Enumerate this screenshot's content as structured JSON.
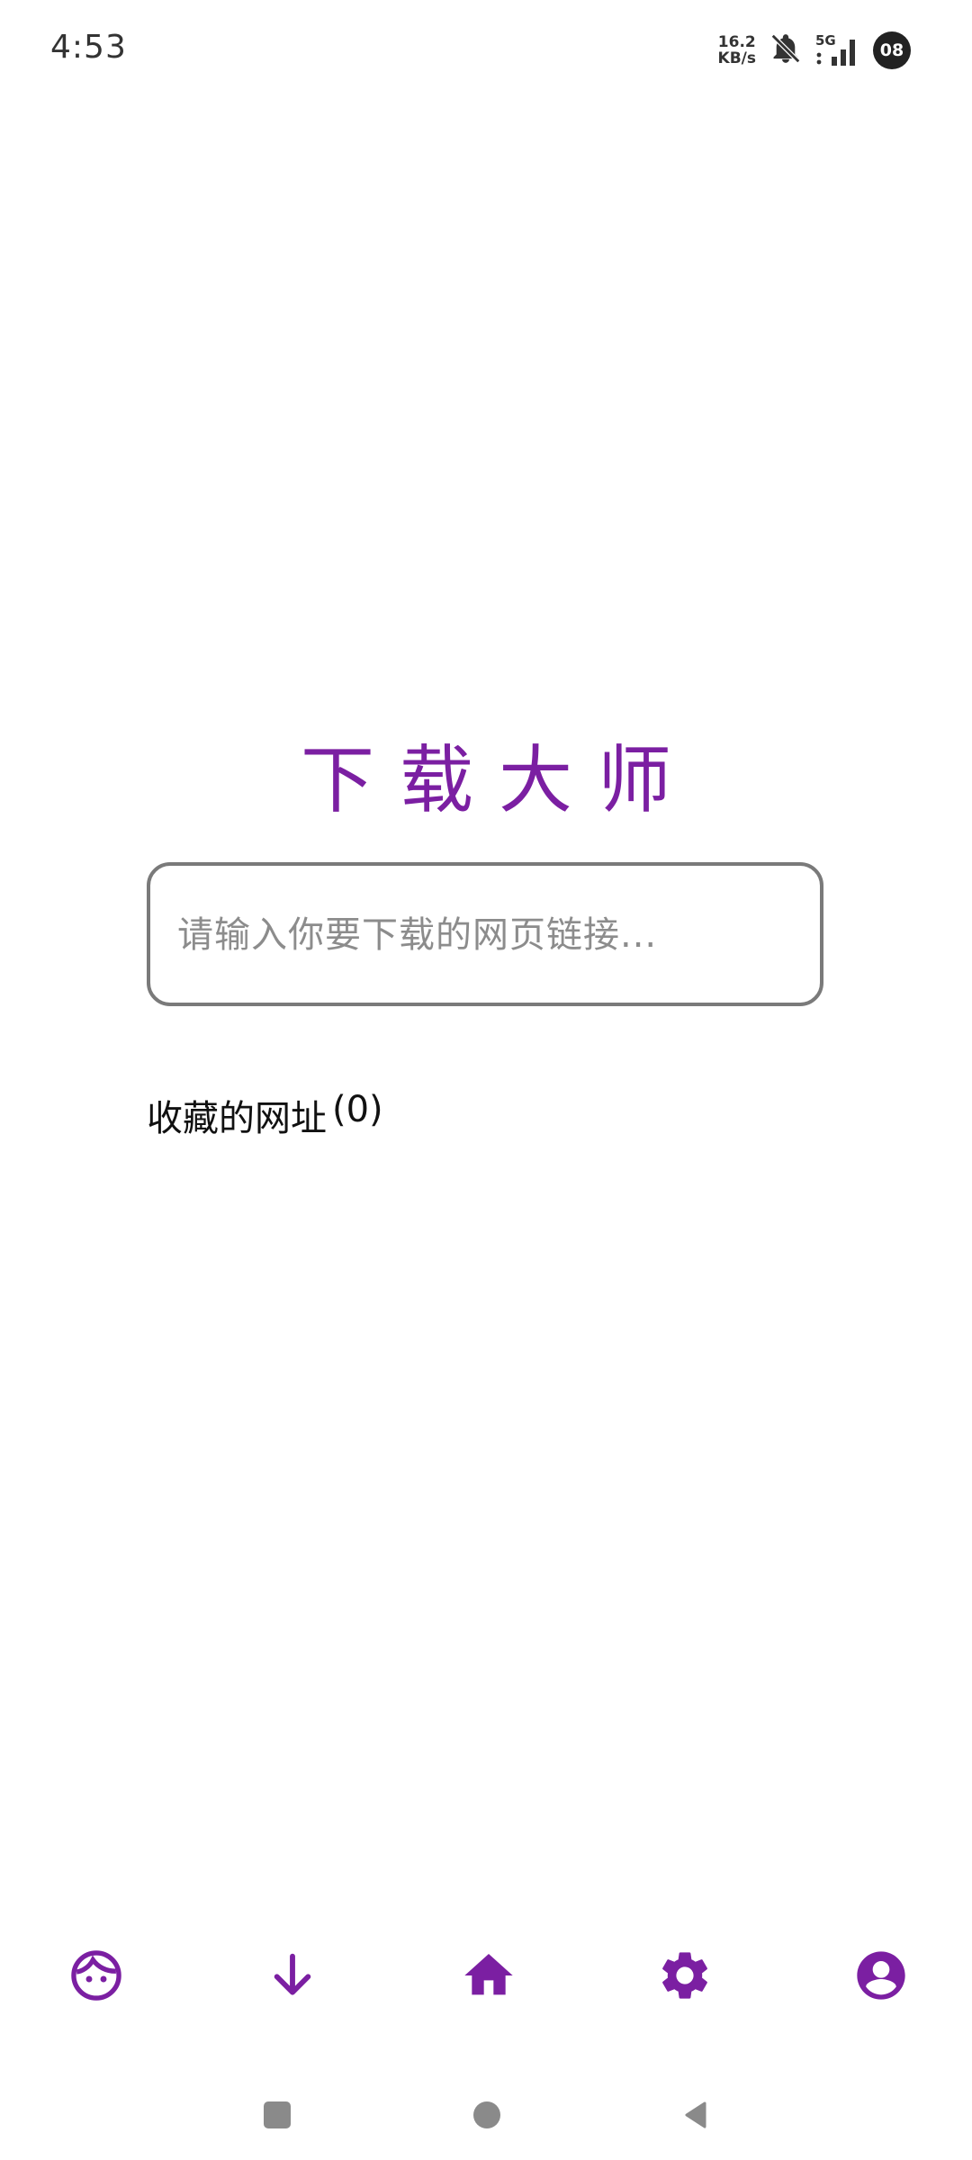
{
  "status_bar": {
    "time": "4:53",
    "net_speed_value": "16.2",
    "net_speed_unit": "KB/s",
    "network_type": "5G",
    "battery": "08"
  },
  "app": {
    "title": "下载大师"
  },
  "url_input": {
    "placeholder": "请输入你要下载的网页链接...",
    "value": ""
  },
  "favorites": {
    "label": "收藏的网址",
    "count": "(0)"
  },
  "colors": {
    "accent": "#7b1fa2",
    "input_border": "#7a7a7a"
  },
  "bottom_nav": {
    "items": [
      {
        "icon": "face-icon"
      },
      {
        "icon": "download-icon"
      },
      {
        "icon": "home-icon"
      },
      {
        "icon": "settings-icon"
      },
      {
        "icon": "account-icon"
      }
    ]
  },
  "system_nav": {
    "items": [
      {
        "icon": "recents-icon"
      },
      {
        "icon": "home-circle-icon"
      },
      {
        "icon": "back-icon"
      }
    ]
  }
}
